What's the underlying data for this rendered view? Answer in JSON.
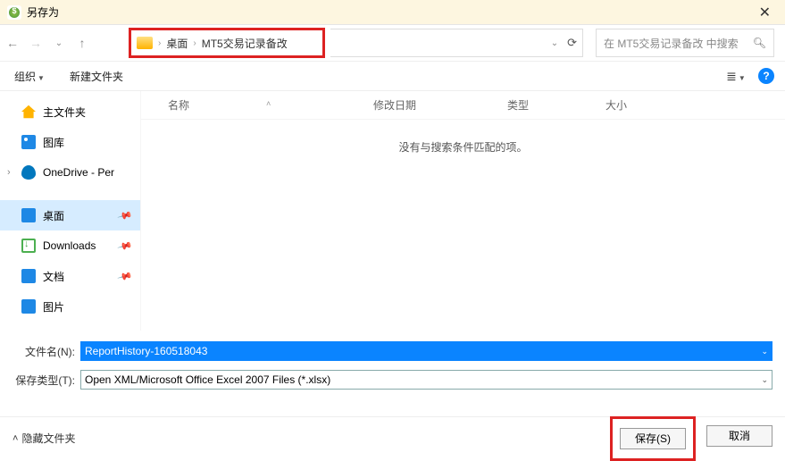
{
  "window": {
    "title": "另存为"
  },
  "breadcrumb": {
    "seg1": "桌面",
    "seg2": "MT5交易记录备改"
  },
  "search": {
    "placeholder": "在 MT5交易记录备改 中搜索"
  },
  "toolbar": {
    "organize": "组织",
    "newfolder": "新建文件夹"
  },
  "sidebar": {
    "home": "主文件夹",
    "gallery": "图库",
    "onedrive": "OneDrive - Per",
    "desktop": "桌面",
    "downloads": "Downloads",
    "documents": "文档",
    "pictures": "图片"
  },
  "columns": {
    "name": "名称",
    "modified": "修改日期",
    "type": "类型",
    "size": "大小"
  },
  "main": {
    "empty_msg": "没有与搜索条件匹配的项。"
  },
  "form": {
    "filename_label": "文件名(N):",
    "filename_value": "ReportHistory-160518043",
    "filetype_label": "保存类型(T):",
    "filetype_value": "Open XML/Microsoft Office Excel 2007 Files (*.xlsx)"
  },
  "footer": {
    "hide_folders": "隐藏文件夹",
    "save": "保存(S)",
    "cancel": "取消"
  }
}
